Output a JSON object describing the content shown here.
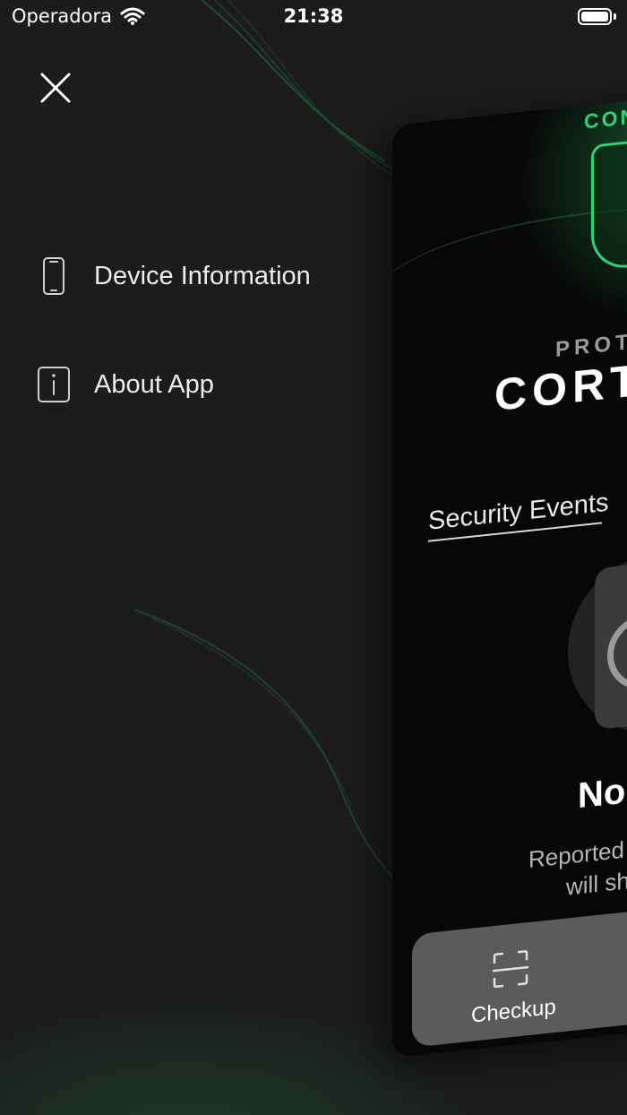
{
  "status_bar": {
    "carrier": "Operadora",
    "time": "21:38"
  },
  "menu": {
    "items": [
      {
        "label": "Device Information",
        "icon": "phone-icon"
      },
      {
        "label": "About App",
        "icon": "info-icon"
      }
    ]
  },
  "preview": {
    "brand_top": "CON",
    "pre_title": "PROT",
    "title": "CORT",
    "section_label": "Security Events",
    "empty_title": "No",
    "empty_text_line1": "Reported",
    "empty_text_line2": "will sh",
    "tab_checkup_label": "Checkup"
  },
  "colors": {
    "background": "#1c1c1d",
    "accent": "#2fd27a",
    "text": "#ececec"
  }
}
